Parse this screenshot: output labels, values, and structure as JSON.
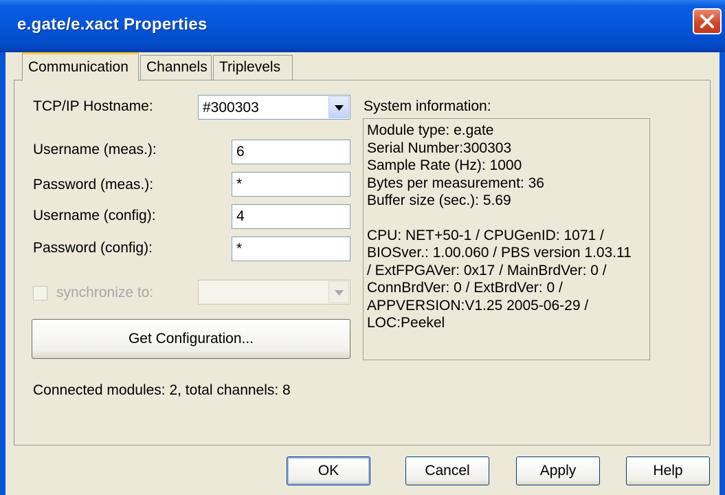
{
  "window": {
    "title": "e.gate/e.xact Properties"
  },
  "tabs": [
    {
      "label": "Communication",
      "active": true
    },
    {
      "label": "Channels",
      "active": false
    },
    {
      "label": "Triplevels",
      "active": false
    }
  ],
  "form": {
    "hostname_label": "TCP/IP Hostname:",
    "hostname_value": "#300303",
    "username_meas_label": "Username (meas.):",
    "username_meas_value": "6",
    "password_meas_label": "Password (meas.):",
    "password_meas_value": "*",
    "username_config_label": "Username (config):",
    "username_config_value": "4",
    "password_config_label": "Password (config):",
    "password_config_value": "*",
    "synchronize_label": "synchronize to:",
    "synchronize_value": "",
    "get_config_label": "Get Configuration..."
  },
  "system_info": {
    "label": "System information:",
    "lines_top": [
      "Module type: e.gate",
      "Serial Number:300303",
      "Sample Rate (Hz): 1000",
      "Bytes per measurement: 36",
      "Buffer size (sec.): 5.69"
    ],
    "lines_bottom": [
      "CPU: NET+50-1 / CPUGenID: 1071 /",
      "BIOSver.: 1.00.060 / PBS version 1.03.11",
      "/ ExtFPGAVer: 0x17 / MainBrdVer: 0 /",
      "ConnBrdVer: 0 / ExtBrdVer: 0 /",
      "APPVERSION:V1.25 2005-06-29 /",
      "LOC:Peekel"
    ]
  },
  "status": {
    "text": "Connected modules: 2, total channels: 8"
  },
  "buttons": {
    "ok": "OK",
    "cancel": "Cancel",
    "apply": "Apply",
    "help": "Help"
  },
  "colors": {
    "titlebar": "#0455d9",
    "face": "#ece9d8",
    "close": "#d2482a",
    "tab_highlight": "#ffc83c"
  }
}
